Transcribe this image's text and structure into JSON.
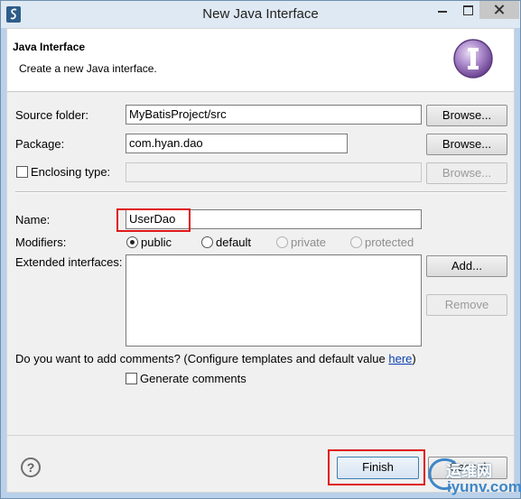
{
  "window": {
    "title": "New Java Interface"
  },
  "banner": {
    "title": "Java Interface",
    "description": "Create a new Java interface."
  },
  "source_folder": {
    "label": "Source folder:",
    "value": "MyBatisProject/src",
    "browse_label": "Browse..."
  },
  "package": {
    "label": "Package:",
    "value": "com.hyan.dao",
    "browse_label": "Browse..."
  },
  "enclosing_type": {
    "label": "Enclosing type:",
    "value": "",
    "checked": false,
    "browse_label": "Browse..."
  },
  "name": {
    "label": "Name:",
    "value": "UserDao"
  },
  "modifiers": {
    "label": "Modifiers:",
    "options": [
      {
        "label": "public",
        "selected": true,
        "enabled": true
      },
      {
        "label": "default",
        "selected": false,
        "enabled": true
      },
      {
        "label": "private",
        "selected": false,
        "enabled": false
      },
      {
        "label": "protected",
        "selected": false,
        "enabled": false
      }
    ]
  },
  "extended_interfaces": {
    "label": "Extended interfaces:",
    "add_label": "Add...",
    "remove_label": "Remove",
    "items": []
  },
  "comments": {
    "question": "Do you want to add comments? (Configure templates and default value ",
    "link": "here",
    "question_end": ")",
    "generate_label": "Generate comments",
    "generate_checked": false
  },
  "footer": {
    "help_glyph": "?",
    "finish_label": "Finish",
    "cancel_label": "Cancel"
  },
  "watermark": {
    "chinese": "运维网",
    "url": "iyunv.com"
  },
  "colors": {
    "highlight_box": "#e0161b",
    "link": "#0a3fb0",
    "finish_border": "#3c7fb1"
  }
}
